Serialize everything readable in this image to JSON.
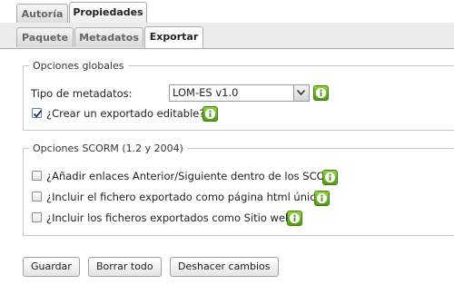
{
  "main_tabs": [
    {
      "label": "Autoría",
      "active": false
    },
    {
      "label": "Propiedades",
      "active": true
    }
  ],
  "sub_tabs": [
    {
      "label": "Paquete",
      "active": false
    },
    {
      "label": "Metadatos",
      "active": false
    },
    {
      "label": "Exportar",
      "active": true
    }
  ],
  "global_options": {
    "legend": "Opciones globales",
    "metadata_type_label": "Tipo de metadatos:",
    "metadata_type_value": "LOM-ES v1.0",
    "editable_export_label": "¿Crear un exportado editable?",
    "editable_export_checked": true
  },
  "scorm_options": {
    "legend": "Opciones SCORM (1.2 y 2004)",
    "items": [
      {
        "label": "¿Añadir enlaces Anterior/Siguiente dentro de los SCO?",
        "checked": false
      },
      {
        "label": "¿Incluir el fichero exportado como página html única?",
        "checked": false
      },
      {
        "label": "¿Incluir los ficheros exportados como Sitio web?",
        "checked": false
      }
    ]
  },
  "buttons": {
    "save": "Guardar",
    "clear_all": "Borrar todo",
    "undo_changes": "Deshacer cambios"
  },
  "colors": {
    "info_icon": "#5ea81c",
    "tab_border": "#a8a8a8",
    "subbar_bg": "#ececec"
  }
}
